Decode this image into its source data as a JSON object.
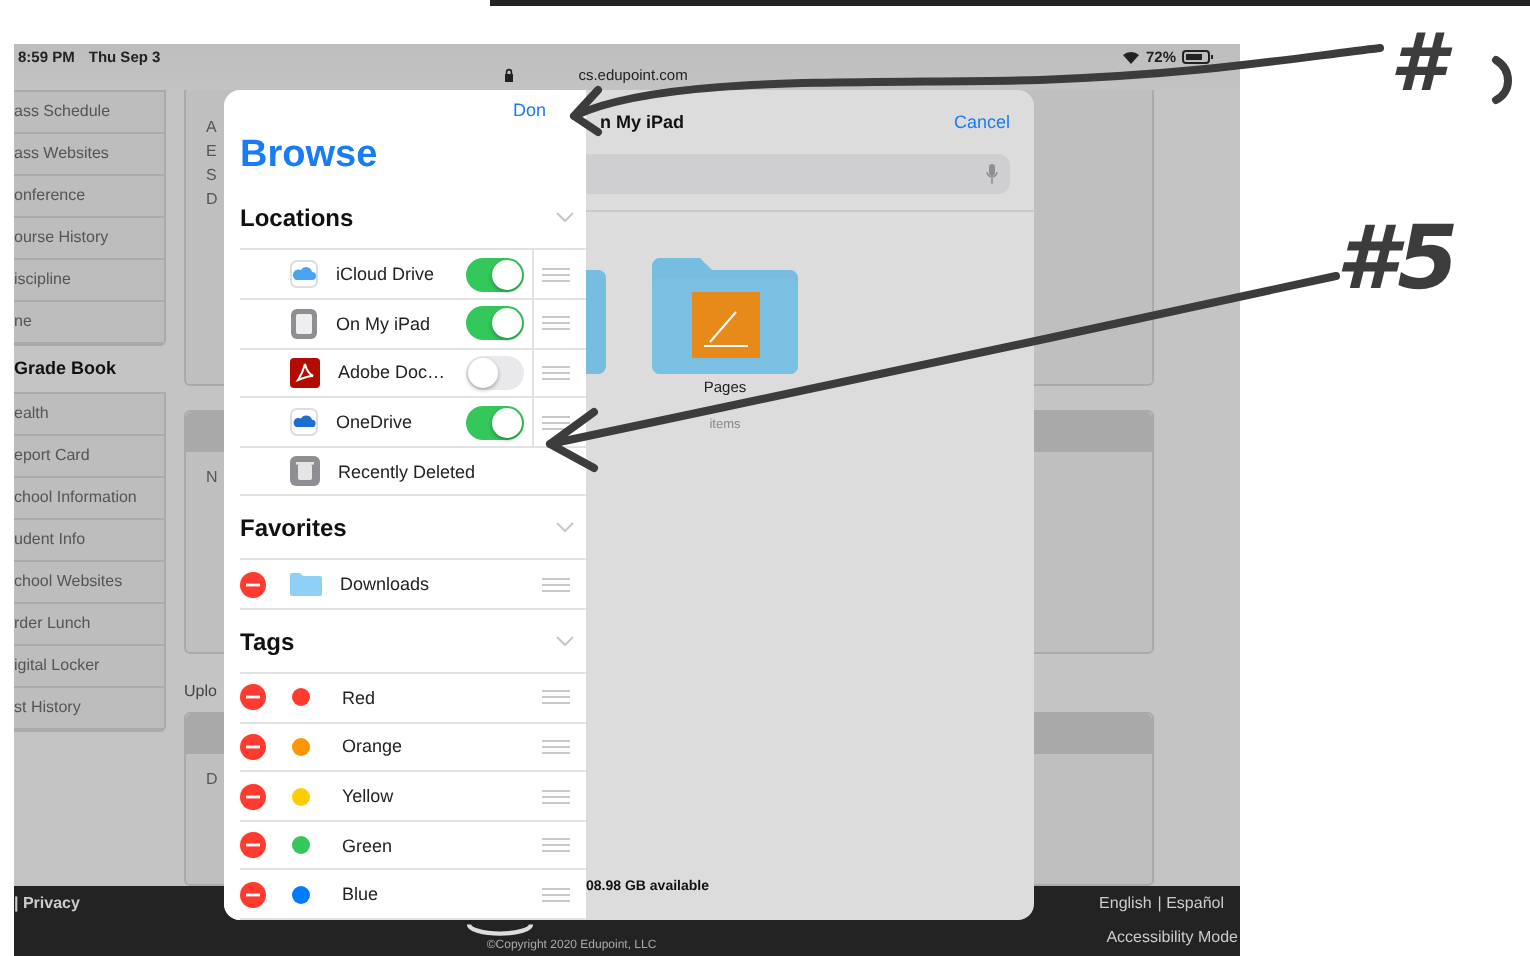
{
  "status_bar": {
    "time": "8:59 PM",
    "date": "Thu Sep 3",
    "url": "cs.edupoint.com",
    "battery": "72%"
  },
  "site_nav": {
    "items_top": [
      {
        "label": "ass Schedule"
      },
      {
        "label": "ass Websites"
      },
      {
        "label": "onference"
      },
      {
        "label": "ourse History"
      },
      {
        "label": "iscipline"
      },
      {
        "label": "ne"
      }
    ],
    "section": "Grade Book",
    "items": [
      {
        "label": "ealth"
      },
      {
        "label": "eport Card"
      },
      {
        "label": "chool Information"
      },
      {
        "label": "udent Info"
      },
      {
        "label": "chool Websites"
      },
      {
        "label": "rder Lunch"
      },
      {
        "label": "igital Locker"
      },
      {
        "label": "st History"
      }
    ]
  },
  "content_fragments": [
    {
      "texts": [
        "A",
        "E",
        "S",
        "D"
      ]
    },
    {
      "texts": [
        "N"
      ]
    },
    {
      "heading": "Uplo",
      "texts": [
        "D"
      ]
    }
  ],
  "footer": {
    "privacy": "| Privacy",
    "languages": [
      "English",
      "| Español"
    ],
    "accessibility": "Accessibility Mode",
    "copyright": "©Copyright 2020 Edupoint, LLC"
  },
  "file_picker": {
    "done": "Don",
    "title": "Browse",
    "sections": [
      {
        "heading": "Locations",
        "items": [
          {
            "kind": "toggle",
            "label": "iCloud Drive",
            "on": true
          },
          {
            "kind": "toggle",
            "label": "On My iPad",
            "on": true
          },
          {
            "kind": "toggle",
            "label": "Adobe Doc…",
            "on": false
          },
          {
            "kind": "toggle",
            "label": "OneDrive",
            "on": true
          },
          {
            "kind": "plain",
            "label": "Recently Deleted"
          }
        ]
      },
      {
        "heading": "Favorites",
        "items": [
          {
            "kind": "removable",
            "label": "Downloads"
          }
        ]
      },
      {
        "heading": "Tags",
        "items": [
          {
            "kind": "tag",
            "label": "Red",
            "color": "#ff3b30"
          },
          {
            "kind": "tag",
            "label": "Orange",
            "color": "#ff9500"
          },
          {
            "kind": "tag",
            "label": "Yellow",
            "color": "#ffcc00"
          },
          {
            "kind": "tag",
            "label": "Green",
            "color": "#34c759"
          },
          {
            "kind": "tag",
            "label": "Blue",
            "color": "#007aff"
          }
        ]
      }
    ],
    "location_title": "n My iPad",
    "cancel": "Cancel",
    "folders": [
      {
        "label": "Pages",
        "detail": "items"
      }
    ],
    "storage": "08.98 GB available"
  },
  "annotations": [
    {
      "label": "#"
    },
    {
      "label": "#5"
    }
  ]
}
